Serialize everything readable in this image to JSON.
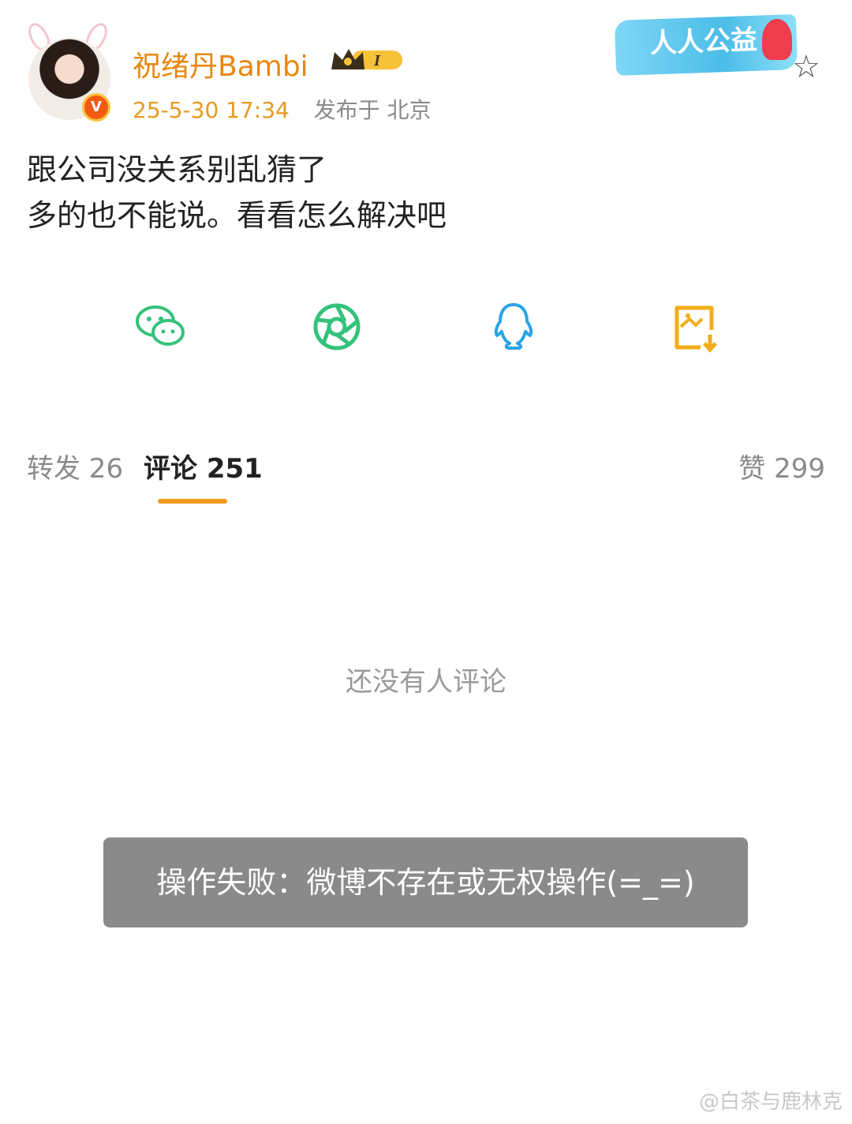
{
  "post": {
    "author": "祝绪丹Bambi",
    "vip_level": "I",
    "time": "25-5-30 17:34",
    "location": "发布于 北京",
    "charity_badge": "人人公益",
    "lines": [
      "跟公司没关系别乱猜了",
      "多的也不能说。看看怎么解决吧"
    ]
  },
  "share": {
    "items": [
      {
        "icon": "wechat-icon",
        "color": "#35c27b"
      },
      {
        "icon": "moments-icon",
        "color": "#35c27b"
      },
      {
        "icon": "qq-icon",
        "color": "#2ba3e6"
      },
      {
        "icon": "save-image-icon",
        "color": "#f1ad1a"
      }
    ]
  },
  "tabs": {
    "repost": "转发 26",
    "comments": "评论 251",
    "likes": "赞 299"
  },
  "comments": {
    "empty": "还没有人评论"
  },
  "toast": {
    "message": "操作失败：微博不存在或无权操作(=_=)"
  },
  "watermark": "@白茶与鹿林克",
  "colors": {
    "accent": "#f29a18",
    "username": "#e8860f"
  }
}
